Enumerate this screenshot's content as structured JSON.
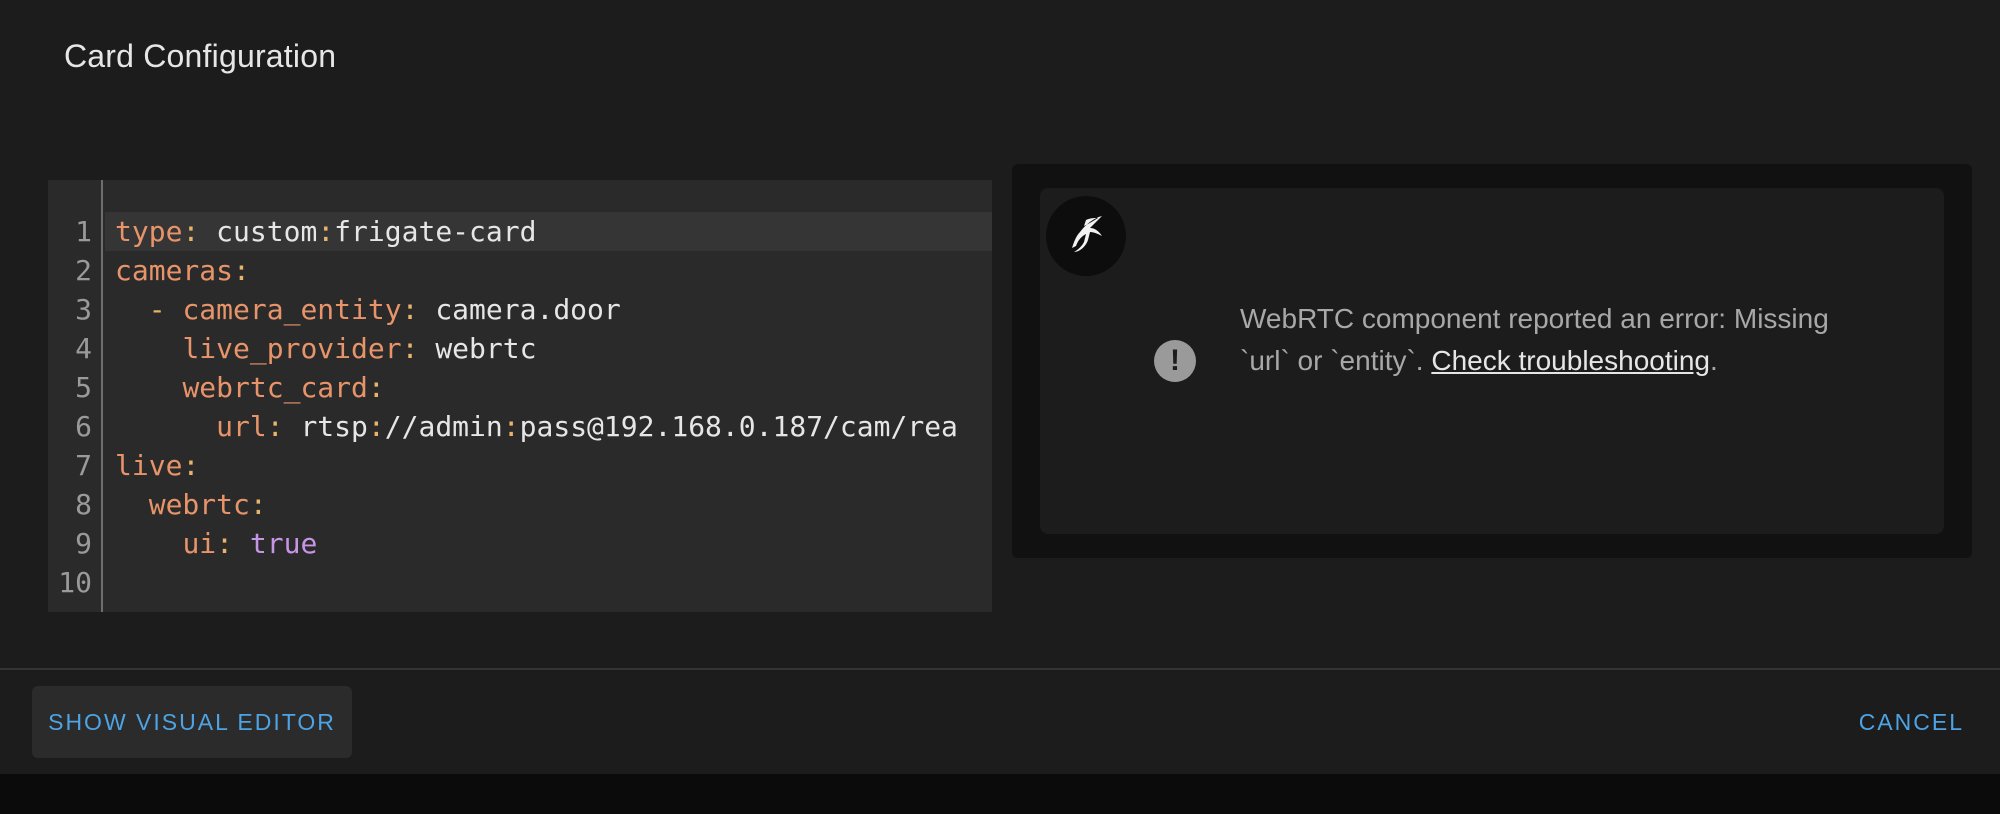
{
  "dialog": {
    "title": "Card Configuration"
  },
  "editor": {
    "lines": [
      {
        "num": "1",
        "parts": [
          {
            "t": "type",
            "c": "k"
          },
          {
            "t": ": ",
            "c": "p"
          },
          {
            "t": "custom",
            "c": "v"
          },
          {
            "t": ":",
            "c": "p"
          },
          {
            "t": "frigate-card",
            "c": "v"
          }
        ]
      },
      {
        "num": "2",
        "parts": [
          {
            "t": "cameras",
            "c": "k"
          },
          {
            "t": ":",
            "c": "p"
          }
        ]
      },
      {
        "num": "3",
        "parts": [
          {
            "t": "  - ",
            "c": "p"
          },
          {
            "t": "camera_entity",
            "c": "k"
          },
          {
            "t": ": ",
            "c": "p"
          },
          {
            "t": "camera.door",
            "c": "v"
          }
        ]
      },
      {
        "num": "4",
        "parts": [
          {
            "t": "    ",
            "c": "p"
          },
          {
            "t": "live_provider",
            "c": "k"
          },
          {
            "t": ": ",
            "c": "p"
          },
          {
            "t": "webrtc",
            "c": "v"
          }
        ]
      },
      {
        "num": "5",
        "parts": [
          {
            "t": "    ",
            "c": "p"
          },
          {
            "t": "webrtc_card",
            "c": "k"
          },
          {
            "t": ":",
            "c": "p"
          }
        ]
      },
      {
        "num": "6",
        "parts": [
          {
            "t": "      ",
            "c": "p"
          },
          {
            "t": "url",
            "c": "k"
          },
          {
            "t": ": ",
            "c": "p"
          },
          {
            "t": "rtsp",
            "c": "v"
          },
          {
            "t": ":",
            "c": "p"
          },
          {
            "t": "//admin",
            "c": "v"
          },
          {
            "t": ":",
            "c": "p"
          },
          {
            "t": "pass@192.168.0.187/cam/rea",
            "c": "v"
          }
        ]
      },
      {
        "num": "7",
        "parts": [
          {
            "t": "live",
            "c": "k"
          },
          {
            "t": ":",
            "c": "p"
          }
        ]
      },
      {
        "num": "8",
        "parts": [
          {
            "t": "  ",
            "c": "p"
          },
          {
            "t": "webrtc",
            "c": "k"
          },
          {
            "t": ":",
            "c": "p"
          }
        ]
      },
      {
        "num": "9",
        "parts": [
          {
            "t": "    ",
            "c": "p"
          },
          {
            "t": "ui",
            "c": "k"
          },
          {
            "t": ": ",
            "c": "p"
          },
          {
            "t": "true",
            "c": "b"
          }
        ]
      },
      {
        "num": "10",
        "parts": []
      }
    ],
    "active_line": "1"
  },
  "preview": {
    "logo_icon": "frigate-bird-icon",
    "error_icon": "alert-circle-icon",
    "error_glyph": "!",
    "error_text": "WebRTC component reported an error: Missing `url` or `entity`. ",
    "error_link": "Check troubleshooting",
    "error_suffix": "."
  },
  "footer": {
    "visual_editor_label": "SHOW VISUAL EDITOR",
    "cancel_label": "CANCEL"
  },
  "colors": {
    "accent": "#4da3e3",
    "yaml_key": "#e8946a",
    "yaml_bool": "#c795e6"
  }
}
